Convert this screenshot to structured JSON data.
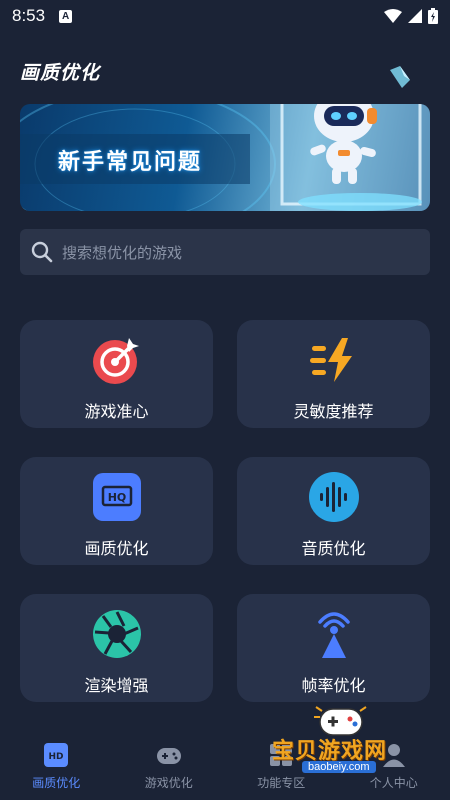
{
  "status": {
    "time": "8:53",
    "notif": "A"
  },
  "header": {
    "title": "画质优化"
  },
  "banner": {
    "text": "新手常见问题"
  },
  "search": {
    "placeholder": "搜索想优化的游戏"
  },
  "features": [
    {
      "label": "游戏准心",
      "icon": "target-icon"
    },
    {
      "label": "灵敏度推荐",
      "icon": "lightning-icon"
    },
    {
      "label": "画质优化",
      "icon": "hd-icon"
    },
    {
      "label": "音质优化",
      "icon": "waveform-icon"
    },
    {
      "label": "渲染增强",
      "icon": "aperture-icon"
    },
    {
      "label": "帧率优化",
      "icon": "broadcast-tower-icon"
    }
  ],
  "nav": [
    {
      "label": "画质优化",
      "icon": "hd-icon",
      "active": true
    },
    {
      "label": "游戏优化",
      "icon": "gamepad-icon",
      "active": false
    },
    {
      "label": "功能专区",
      "icon": "grid-icon",
      "active": false
    },
    {
      "label": "个人中心",
      "icon": "user-icon",
      "active": false
    }
  ],
  "watermark": {
    "text": "宝贝游戏网",
    "url": "baobeiy.com"
  },
  "colors": {
    "bg": "#1b2336",
    "card": "#28324a",
    "accent": "#5b8cff"
  }
}
